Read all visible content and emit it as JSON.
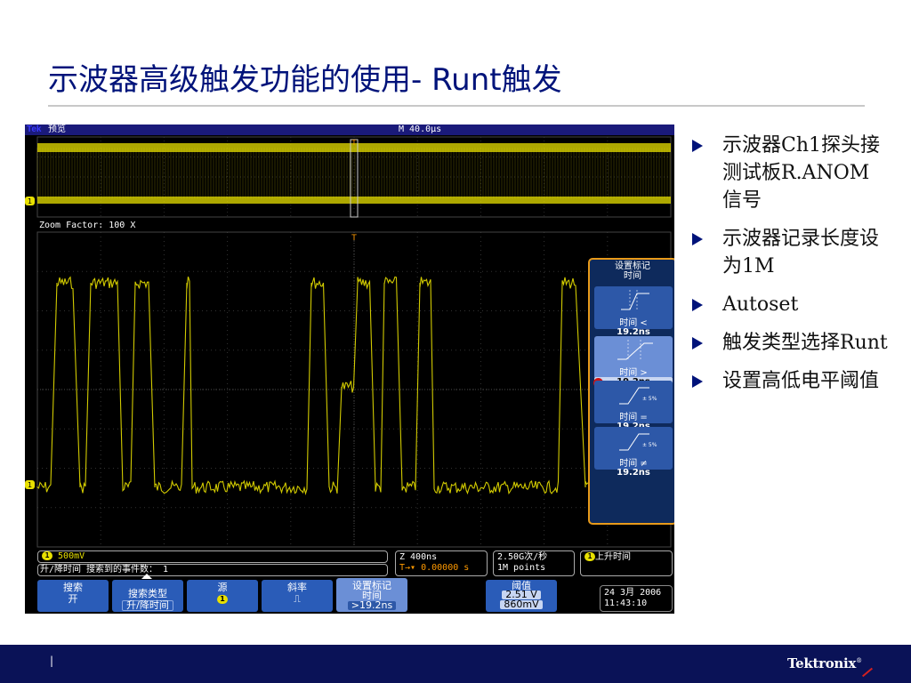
{
  "slide": {
    "title": "示波器高级触发功能的使用- Runt触发",
    "page_marker": "|",
    "logo": "Tektronix",
    "logo_mark": "®",
    "accent_color": "#00137a",
    "footer_color": "#0a1257"
  },
  "scope": {
    "brand": "Tek",
    "mode_label": "预览",
    "record_timescale": "M 40.0µs",
    "zoom_factor": "Zoom Factor: 100 X",
    "channel_marker": "1",
    "trigger_marker": "T",
    "trace_color": "#e8e000",
    "menu": {
      "title_line1": "设置标记",
      "title_line2": "时间",
      "options": [
        {
          "label": "时间 <",
          "value": "19.2ns",
          "selected": false
        },
        {
          "label": "时间 >",
          "value": "19.2ns",
          "selected": true,
          "badge": "a"
        },
        {
          "label": "时间 =",
          "value": "19.2ns",
          "selected": false,
          "note": "± 5%"
        },
        {
          "label": "时间 ≠",
          "value": "19.2ns",
          "selected": false,
          "note": "± 5%"
        }
      ]
    },
    "status": {
      "ch1_scale": "500mV",
      "search_result": "升/降时间 搜索到的事件数： 1",
      "horizontal_scale": "Z 400ns",
      "trigger_position": "0.00000 s",
      "sample_rate": "2.50G次/秒",
      "record_length": "1M points",
      "trigger_type": "上升时间"
    },
    "buttons": [
      {
        "line1": "搜索",
        "line2": "开"
      },
      {
        "line1": "搜索类型",
        "line2": "升/降时间"
      },
      {
        "line1": "源",
        "line2": "1"
      },
      {
        "line1": "斜率",
        "line2": "⎍"
      },
      {
        "line1": "设置标记",
        "line2": "时间",
        "line3": ">19.2ns"
      },
      {
        "line1": "阈值",
        "line2": "2.51 V",
        "line3": "860mV"
      }
    ],
    "date": "24 3月  2006",
    "time": "11:43:10"
  },
  "bullets": [
    "示波器Ch1探头接测试板R.ANOM信号",
    "示波器记录长度设为1M",
    "Autoset",
    "触发类型选择Runt",
    "设置高低电平阈值"
  ]
}
